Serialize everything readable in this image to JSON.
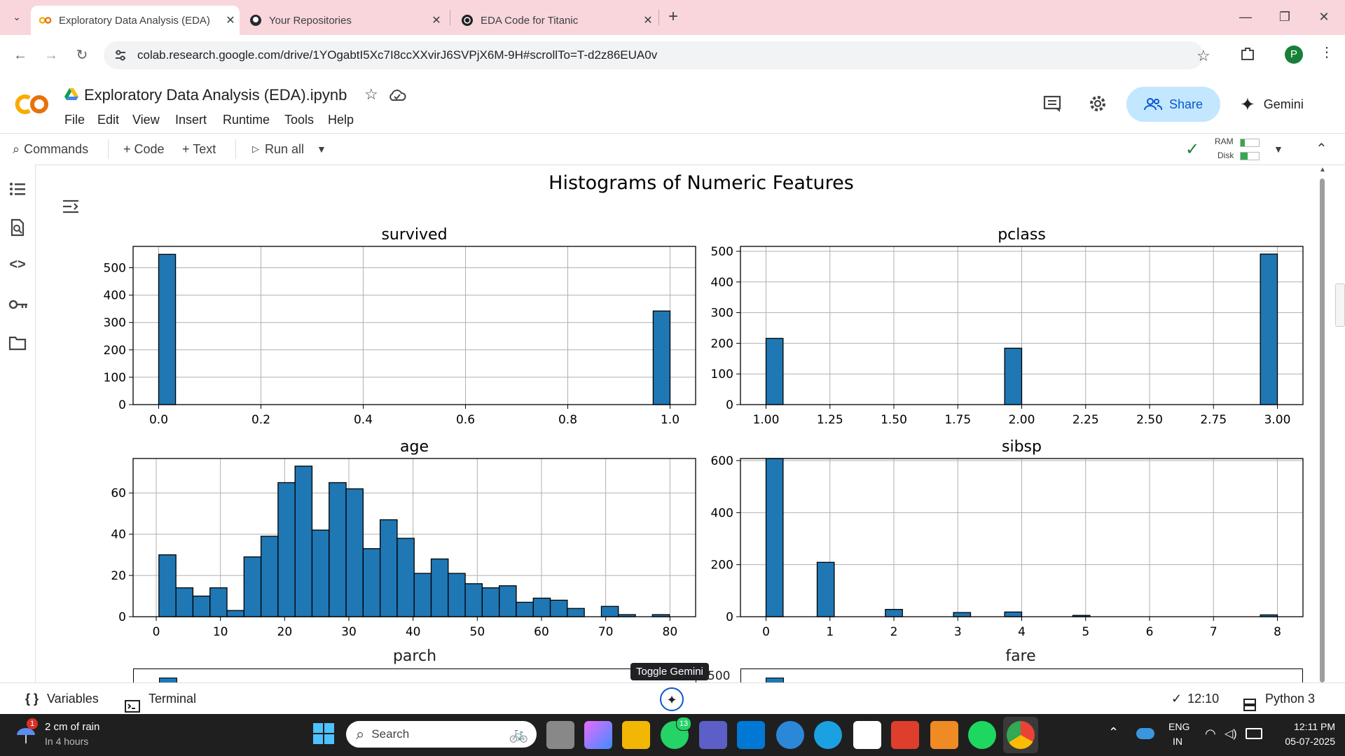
{
  "browser": {
    "tabs": [
      {
        "title": "Exploratory Data Analysis (EDA)",
        "active": true
      },
      {
        "title": "Your Repositories",
        "active": false
      },
      {
        "title": "EDA Code for Titanic",
        "active": false
      }
    ],
    "url": "colab.research.google.com/drive/1YOgabtI5Xc7I8ccXXvirJ6SVPjX6M-9H#scrollTo=T-d2z86EUA0v",
    "profile_initial": "P"
  },
  "colab": {
    "logo_text": "CO",
    "doc_title": "Exploratory Data Analysis (EDA).ipynb",
    "menu": [
      "File",
      "Edit",
      "View",
      "Insert",
      "Runtime",
      "Tools",
      "Help"
    ],
    "share_label": "Share",
    "gemini_label": "Gemini",
    "toolbar": {
      "commands": "Commands",
      "code": "+ Code",
      "text": "+ Text",
      "run_all": "Run all",
      "ram": "RAM",
      "disk": "Disk"
    }
  },
  "figure": {
    "title": "Histograms of Numeric Features",
    "bar_color": "#1f77b4"
  },
  "chart_data": [
    {
      "type": "bar",
      "title": "survived",
      "xticks": [
        "0.0",
        "0.2",
        "0.4",
        "0.6",
        "0.8",
        "1.0"
      ],
      "yticks": [
        "0",
        "100",
        "200",
        "300",
        "400",
        "500"
      ],
      "xlim": [
        -0.05,
        1.05
      ],
      "ylim": [
        0,
        578
      ],
      "bins": [
        {
          "x": 0.0,
          "w": 0.033,
          "v": 549
        },
        {
          "x": 0.967,
          "w": 0.033,
          "v": 342
        }
      ]
    },
    {
      "type": "bar",
      "title": "pclass",
      "xticks": [
        "1.00",
        "1.25",
        "1.50",
        "1.75",
        "2.00",
        "2.25",
        "2.50",
        "2.75",
        "3.00"
      ],
      "yticks": [
        "0",
        "100",
        "200",
        "300",
        "400",
        "500"
      ],
      "xlim": [
        0.9,
        3.1
      ],
      "ylim": [
        0,
        516
      ],
      "bins": [
        {
          "x": 1.0,
          "w": 0.0667,
          "v": 216
        },
        {
          "x": 1.9333,
          "w": 0.0667,
          "v": 184
        },
        {
          "x": 2.9333,
          "w": 0.0667,
          "v": 491
        }
      ]
    },
    {
      "type": "bar",
      "title": "age",
      "xticks": [
        "0",
        "10",
        "20",
        "30",
        "40",
        "50",
        "60",
        "70",
        "80"
      ],
      "yticks": [
        "0",
        "20",
        "40",
        "60"
      ],
      "xlim": [
        -3.6,
        84.0
      ],
      "ylim": [
        0,
        76.7
      ],
      "bins": [
        {
          "x": 0.42,
          "w": 2.65,
          "v": 30
        },
        {
          "x": 3.07,
          "w": 2.65,
          "v": 14
        },
        {
          "x": 5.72,
          "w": 2.65,
          "v": 10
        },
        {
          "x": 8.37,
          "w": 2.65,
          "v": 14
        },
        {
          "x": 11.02,
          "w": 2.65,
          "v": 3
        },
        {
          "x": 13.67,
          "w": 2.65,
          "v": 29
        },
        {
          "x": 16.32,
          "w": 2.65,
          "v": 39
        },
        {
          "x": 18.97,
          "w": 2.65,
          "v": 65
        },
        {
          "x": 21.62,
          "w": 2.65,
          "v": 73
        },
        {
          "x": 24.27,
          "w": 2.65,
          "v": 42
        },
        {
          "x": 26.92,
          "w": 2.65,
          "v": 65
        },
        {
          "x": 29.57,
          "w": 2.65,
          "v": 62
        },
        {
          "x": 32.22,
          "w": 2.65,
          "v": 33
        },
        {
          "x": 34.87,
          "w": 2.65,
          "v": 47
        },
        {
          "x": 37.52,
          "w": 2.65,
          "v": 38
        },
        {
          "x": 40.17,
          "w": 2.65,
          "v": 21
        },
        {
          "x": 42.82,
          "w": 2.65,
          "v": 28
        },
        {
          "x": 45.47,
          "w": 2.65,
          "v": 21
        },
        {
          "x": 48.12,
          "w": 2.65,
          "v": 16
        },
        {
          "x": 50.77,
          "w": 2.65,
          "v": 14
        },
        {
          "x": 53.42,
          "w": 2.65,
          "v": 15
        },
        {
          "x": 56.07,
          "w": 2.65,
          "v": 7
        },
        {
          "x": 58.72,
          "w": 2.65,
          "v": 9
        },
        {
          "x": 61.37,
          "w": 2.65,
          "v": 8
        },
        {
          "x": 64.02,
          "w": 2.65,
          "v": 4
        },
        {
          "x": 66.67,
          "w": 2.65,
          "v": 0
        },
        {
          "x": 69.32,
          "w": 2.65,
          "v": 5
        },
        {
          "x": 71.97,
          "w": 2.65,
          "v": 1
        },
        {
          "x": 74.62,
          "w": 2.65,
          "v": 0
        },
        {
          "x": 77.27,
          "w": 2.65,
          "v": 1
        }
      ]
    },
    {
      "type": "bar",
      "title": "sibsp",
      "xticks": [
        "0",
        "1",
        "2",
        "3",
        "4",
        "5",
        "6",
        "7",
        "8"
      ],
      "yticks": [
        "0",
        "200",
        "400",
        "600"
      ],
      "xlim": [
        -0.4,
        8.4
      ],
      "ylim": [
        0,
        608
      ],
      "bins": [
        {
          "x": 0.0,
          "w": 0.267,
          "v": 608
        },
        {
          "x": 0.8,
          "w": 0.267,
          "v": 209
        },
        {
          "x": 1.867,
          "w": 0.267,
          "v": 28
        },
        {
          "x": 2.933,
          "w": 0.267,
          "v": 16
        },
        {
          "x": 3.733,
          "w": 0.267,
          "v": 18
        },
        {
          "x": 4.8,
          "w": 0.267,
          "v": 5
        },
        {
          "x": 7.733,
          "w": 0.267,
          "v": 7
        }
      ]
    }
  ],
  "partial_titles": {
    "parch": "parch",
    "fare": "fare",
    "fare_tick": "500"
  },
  "tooltip": "Toggle Gemini",
  "status": {
    "variables": "Variables",
    "terminal": "Terminal",
    "time": "12:10",
    "kernel": "Python 3"
  },
  "taskbar": {
    "weather_line1": "2 cm of rain",
    "weather_line2": "In 4 hours",
    "weather_badge": "1",
    "search": "Search",
    "whatsapp_badge": "13",
    "lang1": "ENG",
    "lang2": "IN",
    "clock_time": "12:11 PM",
    "clock_date": "05-07-2025"
  }
}
